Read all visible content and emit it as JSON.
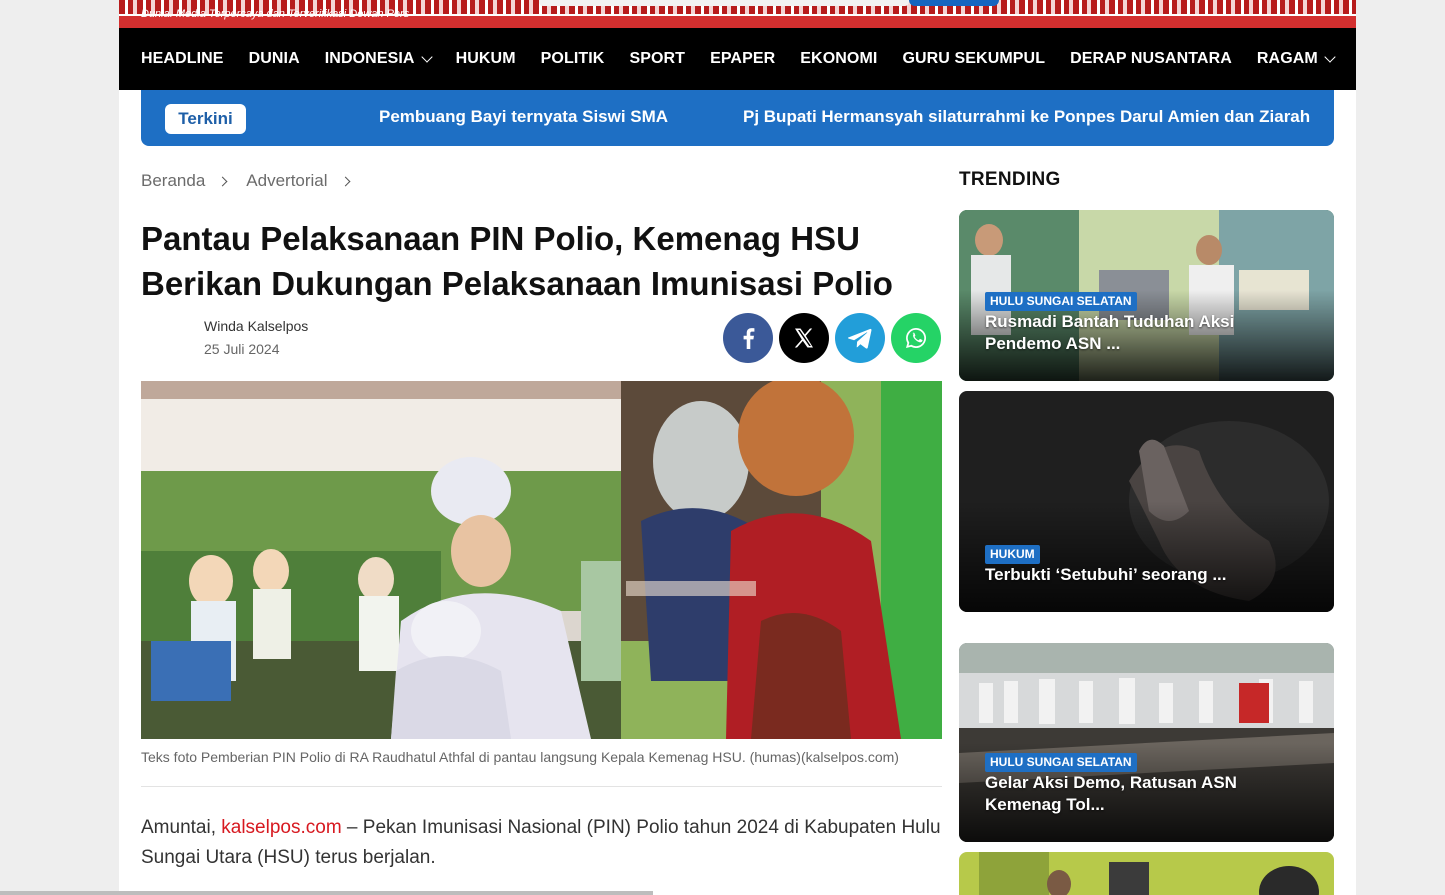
{
  "banner": {
    "tagline": "Dunia. Media Terpercaya dan Terverifikasi Dewan Pers"
  },
  "nav": {
    "items": [
      {
        "label": "HEADLINE",
        "dropdown": false
      },
      {
        "label": "DUNIA",
        "dropdown": false
      },
      {
        "label": "INDONESIA",
        "dropdown": true
      },
      {
        "label": "HUKUM",
        "dropdown": false
      },
      {
        "label": "POLITIK",
        "dropdown": false
      },
      {
        "label": "SPORT",
        "dropdown": false
      },
      {
        "label": "EPAPER",
        "dropdown": false
      },
      {
        "label": "EKONOMI",
        "dropdown": false
      },
      {
        "label": "GURU SEKUMPUL",
        "dropdown": false
      },
      {
        "label": "DERAP NUSANTARA",
        "dropdown": false
      },
      {
        "label": "RAGAM",
        "dropdown": true
      }
    ]
  },
  "ticker": {
    "badge": "Terkini",
    "items": [
      "Pembuang Bayi ternyata Siswi SMA",
      "Pj Bupati Hermansyah silaturrahmi ke Ponpes Darul Amien dan Ziarah"
    ]
  },
  "breadcrumb": {
    "home": "Beranda",
    "category": "Advertorial"
  },
  "article": {
    "title": "Pantau Pelaksanaan PIN Polio, Kemenag HSU Berikan Dukungan Pelaksanaan Imunisasi Polio",
    "author": "Winda Kalselpos",
    "date": "25 Juli 2024",
    "caption": "Teks foto Pemberian PIN Polio di RA Raudhatul Athfal di pantau langsung Kepala Kemenag HSU. (humas)(kalselpos.com)",
    "body_prefix": "Amuntai, ",
    "body_link": "kalselpos.com",
    "body_rest": " – Pekan Imunisasi Nasional (PIN) Polio tahun 2024 di Kabupaten Hulu Sungai Utara (HSU) terus berjalan."
  },
  "share": {
    "icons": [
      "facebook-icon",
      "x-icon",
      "telegram-icon",
      "whatsapp-icon"
    ],
    "colors": [
      "#3b5998",
      "#000000",
      "#229ed9",
      "#25d366"
    ]
  },
  "sidebar": {
    "heading": "TRENDING",
    "cards": [
      {
        "category": "HULU SUNGAI SELATAN",
        "title": "Rusmadi Bantah Tuduhan Aksi Pendemo ASN ..."
      },
      {
        "category": "HUKUM",
        "title": "Terbukti ‘Setubuhi’ seorang ..."
      },
      {
        "category": "HULU SUNGAI SELATAN",
        "title": "Gelar Aksi Demo, Ratusan ASN Kemenag Tol..."
      }
    ]
  },
  "colors": {
    "accent_blue": "#1e6fc4",
    "link_red": "#d71920",
    "nav_bg": "#000000"
  }
}
